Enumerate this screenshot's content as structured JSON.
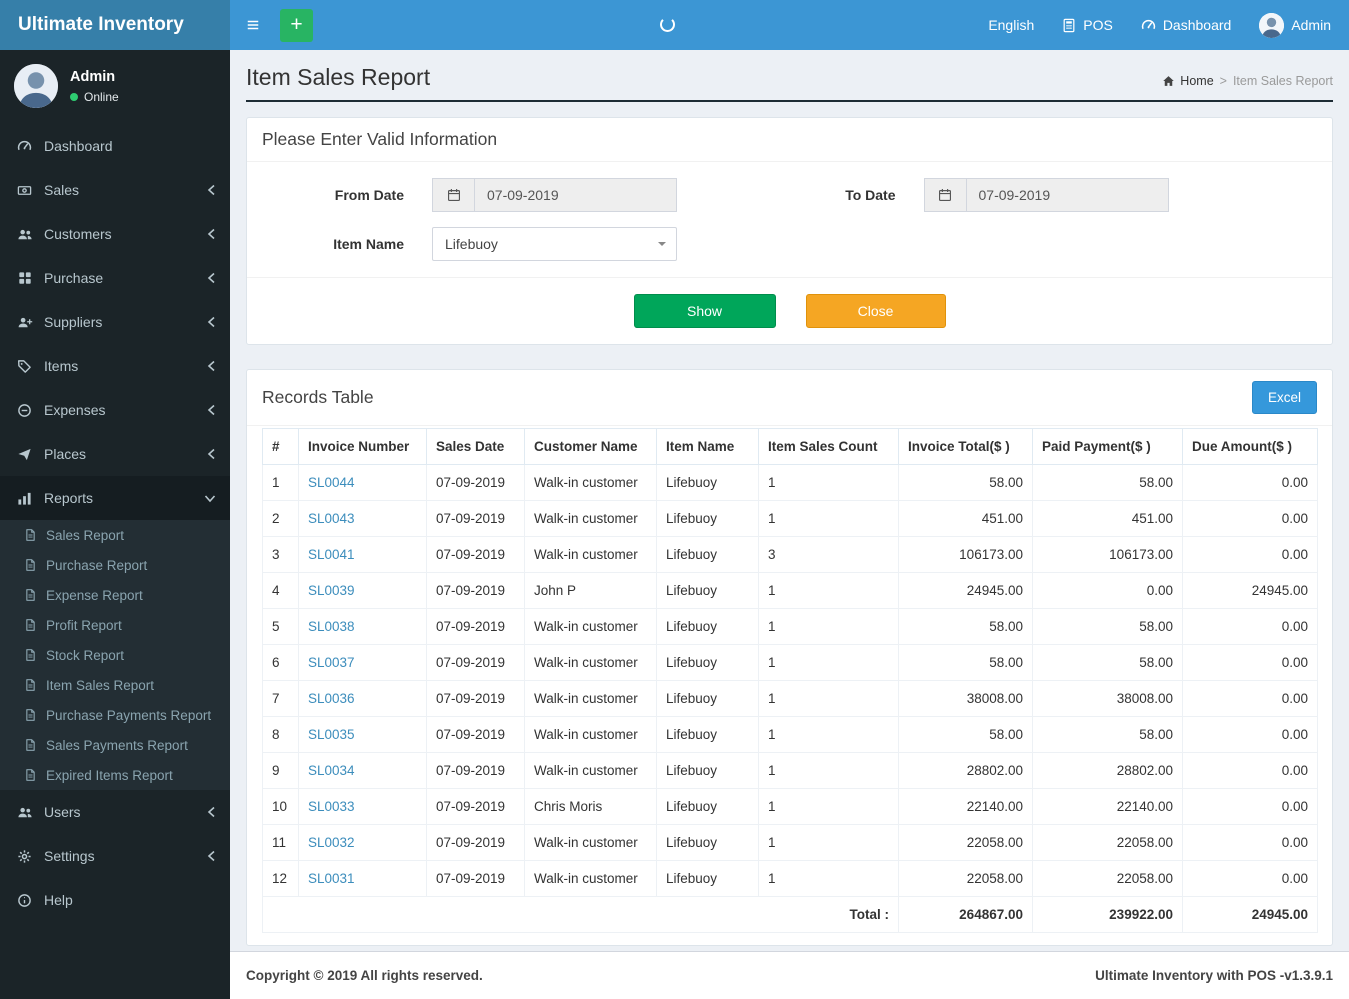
{
  "brand": "Ultimate Inventory",
  "navbar": {
    "add_label": "+",
    "language": "English",
    "pos": "POS",
    "dashboard": "Dashboard",
    "user": "Admin"
  },
  "sidebar": {
    "user_name": "Admin",
    "user_status": "Online",
    "items": [
      {
        "label": "Dashboard"
      },
      {
        "label": "Sales"
      },
      {
        "label": "Customers"
      },
      {
        "label": "Purchase"
      },
      {
        "label": "Suppliers"
      },
      {
        "label": "Items"
      },
      {
        "label": "Expenses"
      },
      {
        "label": "Places"
      },
      {
        "label": "Reports"
      },
      {
        "label": "Users"
      },
      {
        "label": "Settings"
      },
      {
        "label": "Help"
      }
    ],
    "reports_submenu": [
      "Sales Report",
      "Purchase Report",
      "Expense Report",
      "Profit Report",
      "Stock Report",
      "Item Sales Report",
      "Purchase Payments Report",
      "Sales Payments Report",
      "Expired Items Report"
    ]
  },
  "page": {
    "title": "Item Sales Report",
    "breadcrumb_home": "Home",
    "breadcrumb_separator": ">",
    "breadcrumb_current": "Item Sales Report"
  },
  "form": {
    "title": "Please Enter Valid Information",
    "from_date_label": "From Date",
    "from_date_value": "07-09-2019",
    "to_date_label": "To Date",
    "to_date_value": "07-09-2019",
    "item_name_label": "Item Name",
    "item_name_value": "Lifebuoy",
    "show_button": "Show",
    "close_button": "Close"
  },
  "records": {
    "title": "Records Table",
    "excel_button": "Excel",
    "columns": [
      "#",
      "Invoice Number",
      "Sales Date",
      "Customer Name",
      "Item Name",
      "Item Sales Count",
      "Invoice Total($ )",
      "Paid Payment($ )",
      "Due Amount($ )"
    ],
    "rows": [
      {
        "num": "1",
        "invoice": "SL0044",
        "date": "07-09-2019",
        "customer": "Walk-in customer",
        "item": "Lifebuoy",
        "count": "1",
        "total": "58.00",
        "paid": "58.00",
        "due": "0.00"
      },
      {
        "num": "2",
        "invoice": "SL0043",
        "date": "07-09-2019",
        "customer": "Walk-in customer",
        "item": "Lifebuoy",
        "count": "1",
        "total": "451.00",
        "paid": "451.00",
        "due": "0.00"
      },
      {
        "num": "3",
        "invoice": "SL0041",
        "date": "07-09-2019",
        "customer": "Walk-in customer",
        "item": "Lifebuoy",
        "count": "3",
        "total": "106173.00",
        "paid": "106173.00",
        "due": "0.00"
      },
      {
        "num": "4",
        "invoice": "SL0039",
        "date": "07-09-2019",
        "customer": "John P",
        "item": "Lifebuoy",
        "count": "1",
        "total": "24945.00",
        "paid": "0.00",
        "due": "24945.00"
      },
      {
        "num": "5",
        "invoice": "SL0038",
        "date": "07-09-2019",
        "customer": "Walk-in customer",
        "item": "Lifebuoy",
        "count": "1",
        "total": "58.00",
        "paid": "58.00",
        "due": "0.00"
      },
      {
        "num": "6",
        "invoice": "SL0037",
        "date": "07-09-2019",
        "customer": "Walk-in customer",
        "item": "Lifebuoy",
        "count": "1",
        "total": "58.00",
        "paid": "58.00",
        "due": "0.00"
      },
      {
        "num": "7",
        "invoice": "SL0036",
        "date": "07-09-2019",
        "customer": "Walk-in customer",
        "item": "Lifebuoy",
        "count": "1",
        "total": "38008.00",
        "paid": "38008.00",
        "due": "0.00"
      },
      {
        "num": "8",
        "invoice": "SL0035",
        "date": "07-09-2019",
        "customer": "Walk-in customer",
        "item": "Lifebuoy",
        "count": "1",
        "total": "58.00",
        "paid": "58.00",
        "due": "0.00"
      },
      {
        "num": "9",
        "invoice": "SL0034",
        "date": "07-09-2019",
        "customer": "Walk-in customer",
        "item": "Lifebuoy",
        "count": "1",
        "total": "28802.00",
        "paid": "28802.00",
        "due": "0.00"
      },
      {
        "num": "10",
        "invoice": "SL0033",
        "date": "07-09-2019",
        "customer": "Chris Moris",
        "item": "Lifebuoy",
        "count": "1",
        "total": "22140.00",
        "paid": "22140.00",
        "due": "0.00"
      },
      {
        "num": "11",
        "invoice": "SL0032",
        "date": "07-09-2019",
        "customer": "Walk-in customer",
        "item": "Lifebuoy",
        "count": "1",
        "total": "22058.00",
        "paid": "22058.00",
        "due": "0.00"
      },
      {
        "num": "12",
        "invoice": "SL0031",
        "date": "07-09-2019",
        "customer": "Walk-in customer",
        "item": "Lifebuoy",
        "count": "1",
        "total": "22058.00",
        "paid": "22058.00",
        "due": "0.00"
      }
    ],
    "total_label": "Total :",
    "total_invoice": "264867.00",
    "total_paid": "239922.00",
    "total_due": "24945.00"
  },
  "footer": {
    "copyright": "Copyright © 2019 All rights reserved.",
    "version": "Ultimate Inventory with POS -v1.3.9.1"
  },
  "icons": [
    "hamburger-icon",
    "plus-icon",
    "loading-icon",
    "calculator-icon",
    "dashboard-icon",
    "user-avatar",
    "online-dot-icon",
    "chevron-left-icon",
    "chevron-down-icon",
    "home-icon",
    "calendar-icon",
    "file-icon"
  ]
}
